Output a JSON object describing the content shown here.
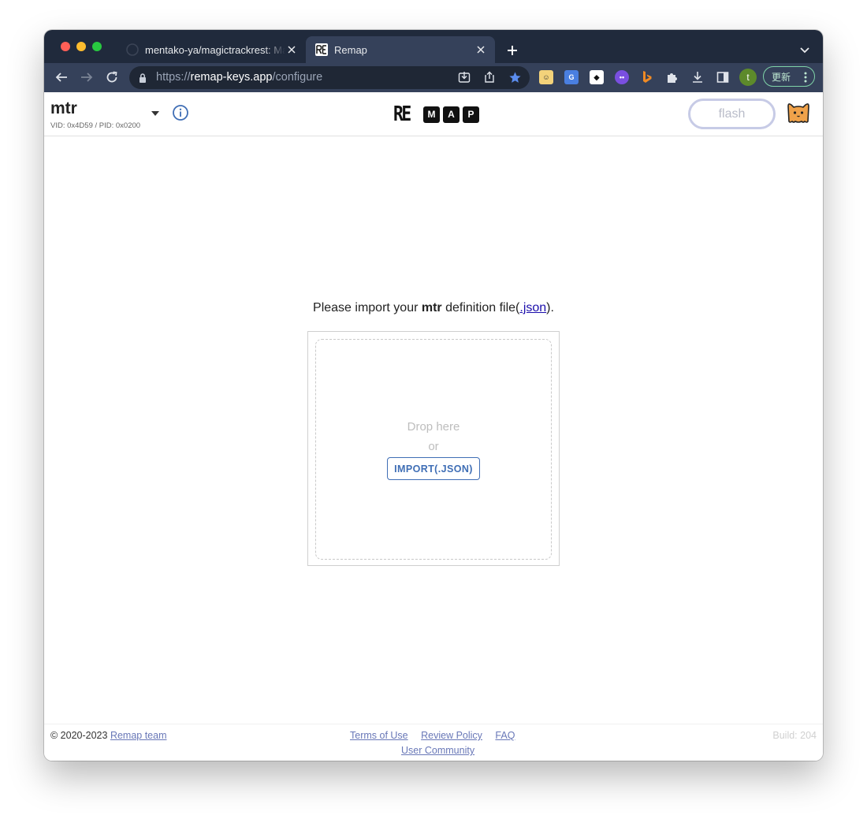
{
  "browser": {
    "tabs": [
      {
        "title": "mentako-ya/magictrackrest: Ma",
        "active": false,
        "favicon": "github-icon"
      },
      {
        "title": "Remap",
        "active": true,
        "favicon": "remap-favicon-icon"
      }
    ],
    "url_scheme": "https://",
    "url_host": "remap-keys.app",
    "url_path": "/configure",
    "profile_initial": "t",
    "update_label": "更新",
    "colors": {
      "tab_strip": "#202a3c",
      "toolbar": "#35415a",
      "omnibox": "#1f2735",
      "bookmark_star": "#5b8def"
    }
  },
  "header": {
    "keyboard_name": "mtr",
    "keyboard_ids": "VID: 0x4D59 / PID: 0x0200",
    "logo_prefix": "RE",
    "logo_boxes": [
      "M",
      "A",
      "P"
    ],
    "flash_label": "flash"
  },
  "main": {
    "prompt_before": "Please import your ",
    "prompt_keyboard": "mtr",
    "prompt_middle": " definition file(",
    "prompt_link": ".json",
    "prompt_after": ").",
    "drop_here": "Drop here",
    "drop_or": "or",
    "import_button": "IMPORT(.JSON)",
    "colors": {
      "import_button": "#3f6eb5",
      "link": "#1a0dab"
    }
  },
  "footer": {
    "copyright": "© 2020-2023 ",
    "team_link": "Remap team",
    "links": [
      "Terms of Use",
      "Review Policy",
      "FAQ"
    ],
    "community_link": "User Community",
    "build": "Build: 204",
    "colors": {
      "link": "#6877b7"
    }
  }
}
